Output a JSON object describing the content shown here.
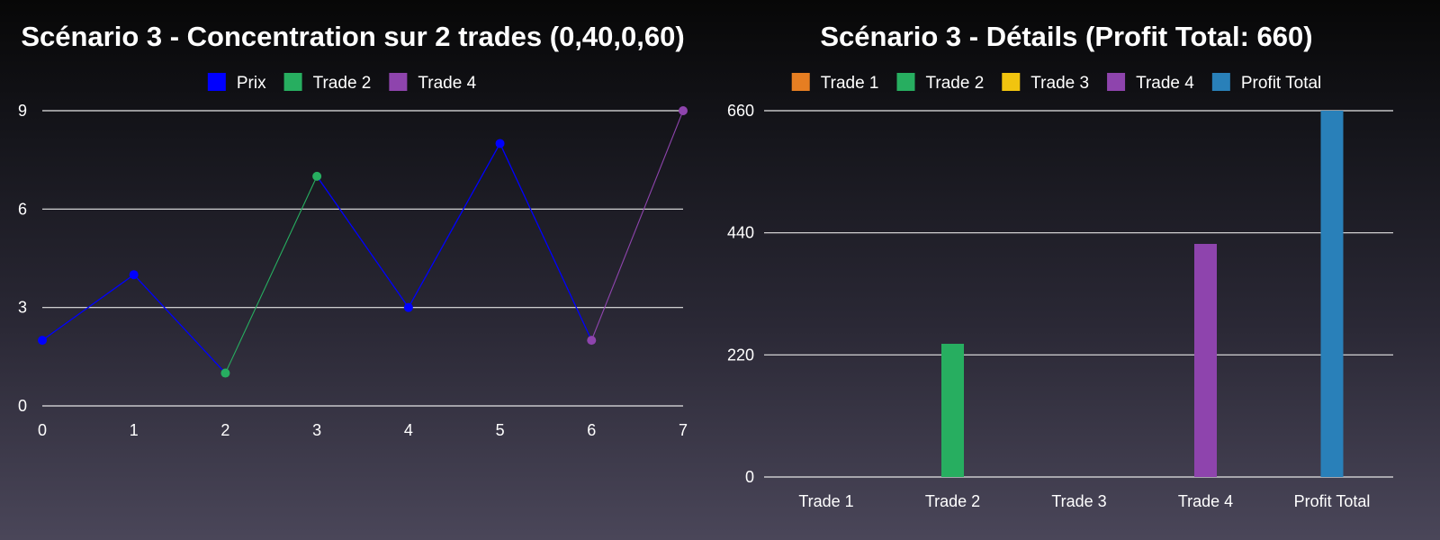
{
  "chart_data": [
    {
      "type": "line",
      "title": "Scénario 3 - Concentration sur 2 trades (0,40,0,60)",
      "xlabel": "",
      "ylabel": "",
      "xlim": [
        0,
        7
      ],
      "ylim": [
        0,
        9
      ],
      "x_ticks": [
        0,
        1,
        2,
        3,
        4,
        5,
        6,
        7
      ],
      "y_ticks": [
        0,
        3,
        6,
        9
      ],
      "grid": "horizontal",
      "legend_placement": "top-center",
      "series": [
        {
          "name": "Prix",
          "color": "#0000ff",
          "x": [
            0,
            1,
            2,
            3,
            4,
            5,
            6,
            7
          ],
          "y": [
            2,
            4,
            1,
            7,
            3,
            8,
            2,
            9
          ]
        },
        {
          "name": "Trade 2",
          "color": "#27ae60",
          "x": [
            2,
            3
          ],
          "y": [
            1,
            7
          ]
        },
        {
          "name": "Trade 4",
          "color": "#8e44ad",
          "x": [
            6,
            7
          ],
          "y": [
            2,
            9
          ]
        }
      ]
    },
    {
      "type": "bar",
      "title": "Scénario 3 - Détails (Profit Total: 660)",
      "xlabel": "",
      "ylabel": "",
      "categories": [
        "Trade 1",
        "Trade 2",
        "Trade 3",
        "Trade 4",
        "Profit Total"
      ],
      "values": [
        0,
        240,
        0,
        420,
        660
      ],
      "colors": [
        "#e67e22",
        "#27ae60",
        "#f1c40f",
        "#8e44ad",
        "#2980b9"
      ],
      "ylim": [
        0,
        660
      ],
      "y_ticks": [
        0,
        220,
        440,
        660
      ],
      "grid": "horizontal",
      "legend_placement": "top-center",
      "legend": [
        {
          "name": "Trade 1",
          "color": "#e67e22"
        },
        {
          "name": "Trade 2",
          "color": "#27ae60"
        },
        {
          "name": "Trade 3",
          "color": "#f1c40f"
        },
        {
          "name": "Trade 4",
          "color": "#8e44ad"
        },
        {
          "name": "Profit Total",
          "color": "#2980b9"
        }
      ]
    }
  ]
}
